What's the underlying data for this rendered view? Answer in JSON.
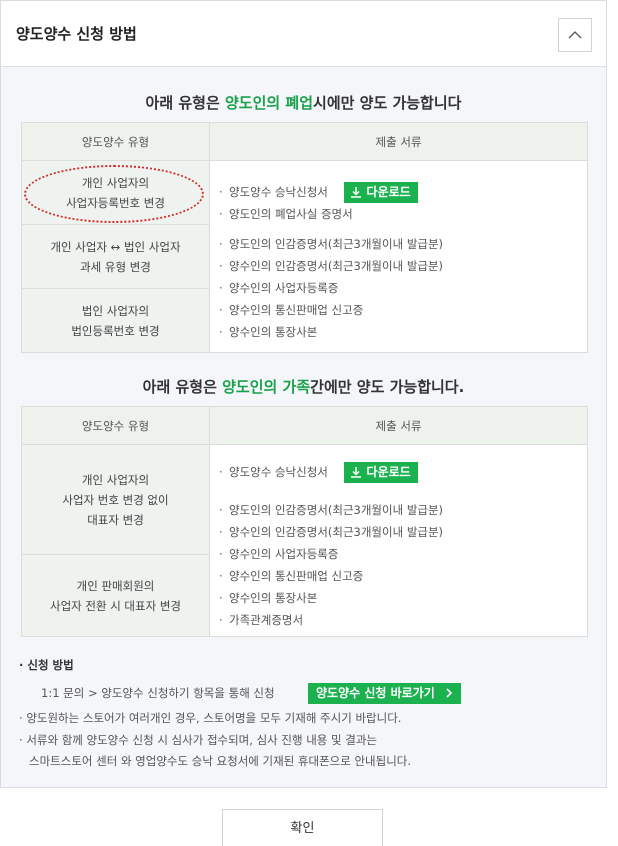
{
  "header": {
    "title": "양도양수 신청 방법"
  },
  "section1": {
    "title_pre": "아래 유형은 ",
    "title_hl": "양도인의 폐업",
    "title_post": "시에만 양도 가능합니다",
    "col_type": "양도양수 유형",
    "col_docs": "제출 서류",
    "types": [
      {
        "line1": "개인 사업자의",
        "line2": "사업자등록번호 변경"
      },
      {
        "line1": "개인 사업자 ↔ 법인 사업자",
        "line2": "과세 유형 변경"
      },
      {
        "line1": "법인 사업자의",
        "line2": "법인등록번호 변경"
      }
    ],
    "docs": [
      "양도양수 승낙신청서",
      "양도인의 폐업사실 증명서",
      "양도인의 인감증명서(최근3개월이내 발급분)",
      "양수인의 인감증명서(최근3개월이내 발급분)",
      "양수인의 사업자등록증",
      "양수인의 통신판매업 신고증",
      "양수인의 통장사본"
    ],
    "download_label": "다운로드"
  },
  "section2": {
    "title_pre": "아래 유형은 ",
    "title_hl": "양도인의 가족",
    "title_post": "간에만 양도 가능합니다.",
    "col_type": "양도양수 유형",
    "col_docs": "제출 서류",
    "types": [
      {
        "line1": "개인 사업자의",
        "line2": "사업자 번호 변경 없이",
        "line3": "대표자 변경"
      },
      {
        "line1": "개인 판매회원의",
        "line2": "사업자 전환 시 대표자 변경"
      }
    ],
    "docs": [
      "양도양수 승낙신청서",
      "양도인의 인감증명서(최근3개월이내 발급분)",
      "양수인의 인감증명서(최근3개월이내 발급분)",
      "양수인의 사업자등록증",
      "양수인의 통신판매업 신고증",
      "양수인의 통장사본",
      "가족관계증명서"
    ],
    "download_label": "다운로드"
  },
  "notes": {
    "method_label": "신청 방법",
    "method_path": "1:1 문의 > 양도양수 신청하기 항목을 통해 신청",
    "shortcut_label": "양도양수 신청 바로가기",
    "note1": "양도원하는 스토어가 여러개인 경우, 스토어명을 모두 기재해 주시기 바랍니다.",
    "note2_line1": "서류와 함께 양도양수 신청 시 심사가 접수되며, 심사 진행 내용 및 결과는",
    "note2_line2": "스마트스토어 센터 와 영업양수도 승낙 요청서에 기재된 휴대폰으로 안내됩니다."
  },
  "footer": {
    "confirm_label": "확인"
  },
  "colors": {
    "accent": "#1ab14e",
    "highlight_text": "#1aa04b",
    "annotation": "#d42b2b"
  },
  "icons": [
    "chevron-up-icon",
    "download-icon",
    "chevron-right-icon"
  ]
}
